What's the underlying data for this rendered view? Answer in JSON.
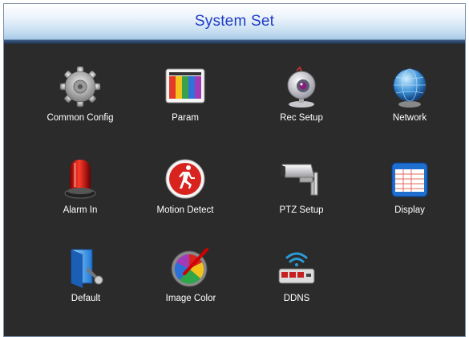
{
  "window": {
    "title": "System Set"
  },
  "menu": {
    "items": [
      {
        "id": "common-config",
        "label": "Common Config",
        "icon": "gear-icon"
      },
      {
        "id": "param",
        "label": "Param",
        "icon": "color-bars-icon"
      },
      {
        "id": "rec-setup",
        "label": "Rec Setup",
        "icon": "webcam-icon"
      },
      {
        "id": "network",
        "label": "Network",
        "icon": "globe-icon"
      },
      {
        "id": "alarm-in",
        "label": "Alarm In",
        "icon": "siren-icon"
      },
      {
        "id": "motion-detect",
        "label": "Motion Detect",
        "icon": "running-man-icon"
      },
      {
        "id": "ptz-setup",
        "label": "PTZ Setup",
        "icon": "security-camera-icon"
      },
      {
        "id": "display",
        "label": "Display",
        "icon": "spreadsheet-window-icon"
      },
      {
        "id": "default",
        "label": "Default",
        "icon": "reset-folder-icon"
      },
      {
        "id": "image-color",
        "label": "Image Color",
        "icon": "palette-icon"
      },
      {
        "id": "ddns",
        "label": "DDNS",
        "icon": "wifi-router-icon"
      }
    ]
  },
  "colors": {
    "title_text": "#1f3cc8",
    "panel_bg": "#2b2b2b",
    "label_text": "#ffffff"
  }
}
